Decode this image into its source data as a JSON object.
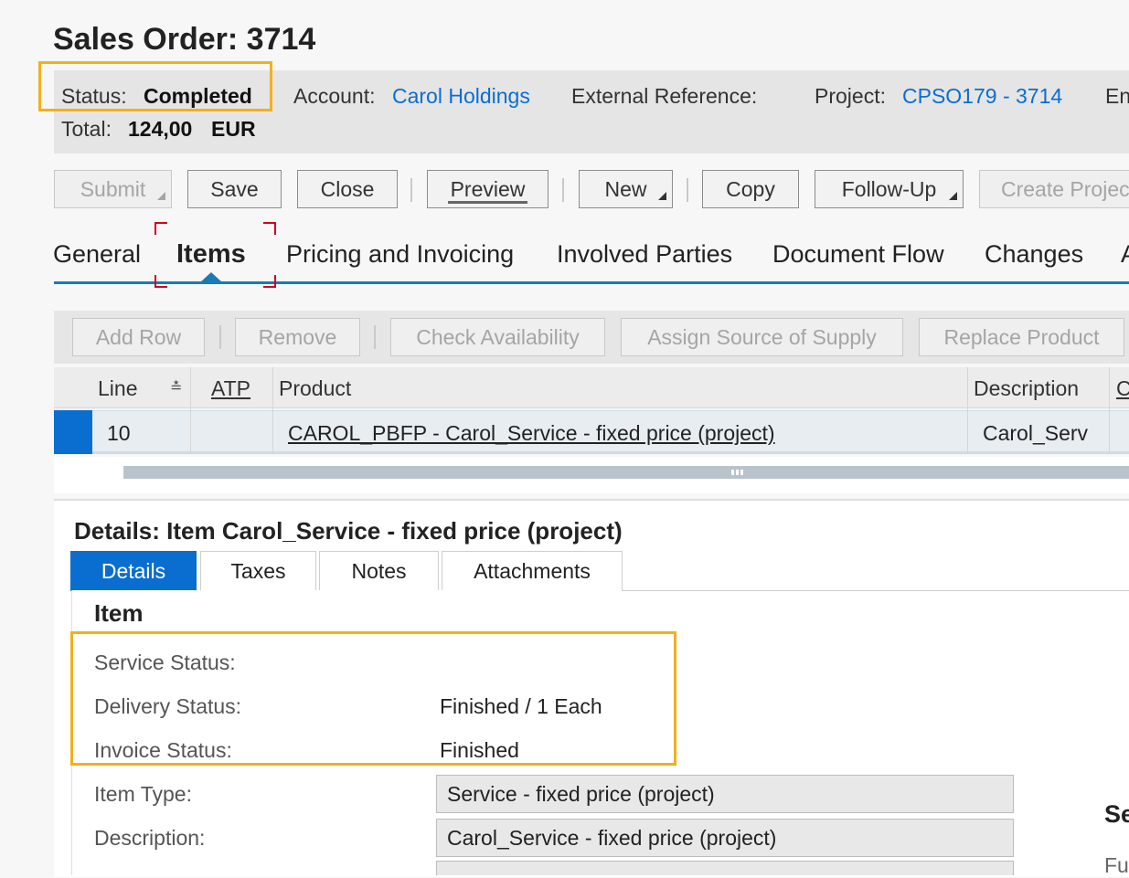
{
  "page": {
    "title": "Sales Order: 3714"
  },
  "header": {
    "status_label": "Status:",
    "status_value": "Completed",
    "account_label": "Account:",
    "account_value": "Carol Holdings",
    "external_ref_label": "External Reference:",
    "project_label": "Project:",
    "project_value": "CPSO179 - 3714",
    "cut_label": "En",
    "total_label": "Total:",
    "total_value": "124,00",
    "total_currency": "EUR"
  },
  "toolbar": {
    "submit": "Submit",
    "save": "Save",
    "close": "Close",
    "preview": "Preview",
    "new": "New",
    "copy": "Copy",
    "follow_up": "Follow-Up",
    "create_project": "Create Projec"
  },
  "tabs": {
    "general": "General",
    "items": "Items",
    "pricing": "Pricing and Invoicing",
    "parties": "Involved Parties",
    "doc_flow": "Document Flow",
    "changes": "Changes",
    "cut": "A"
  },
  "item_toolbar": {
    "add_row": "Add Row",
    "remove": "Remove",
    "check_availability": "Check Availability",
    "assign_source": "Assign Source of Supply",
    "replace_product": "Replace Product"
  },
  "table": {
    "headers": {
      "line": "Line",
      "sort_icon": "≛",
      "atp": "ATP",
      "product": "Product",
      "description": "Description",
      "cut": "C"
    },
    "rows": [
      {
        "line": "10",
        "product": "CAROL_PBFP - Carol_Service - fixed price (project)",
        "description": "Carol_Serv"
      }
    ]
  },
  "details": {
    "title": "Details: Item Carol_Service - fixed price (project)",
    "tabs": {
      "details": "Details",
      "taxes": "Taxes",
      "notes": "Notes",
      "attachments": "Attachments"
    },
    "section_title": "Item",
    "service_status_label": "Service Status:",
    "delivery_status_label": "Delivery Status:",
    "delivery_status_value": "Finished / 1 Each",
    "invoice_status_label": "Invoice Status:",
    "invoice_status_value": "Finished",
    "item_type_label": "Item Type:",
    "item_type_value": "Service - fixed price (project)",
    "description_label": "Description:",
    "description_value": "Carol_Service - fixed price (project)",
    "right_peek_title": "Se",
    "right_peek_text": "Fu"
  },
  "colors": {
    "accent": "#0a6ed1",
    "highlight": "#f2b01e",
    "focus_corner": "#d0021b"
  }
}
